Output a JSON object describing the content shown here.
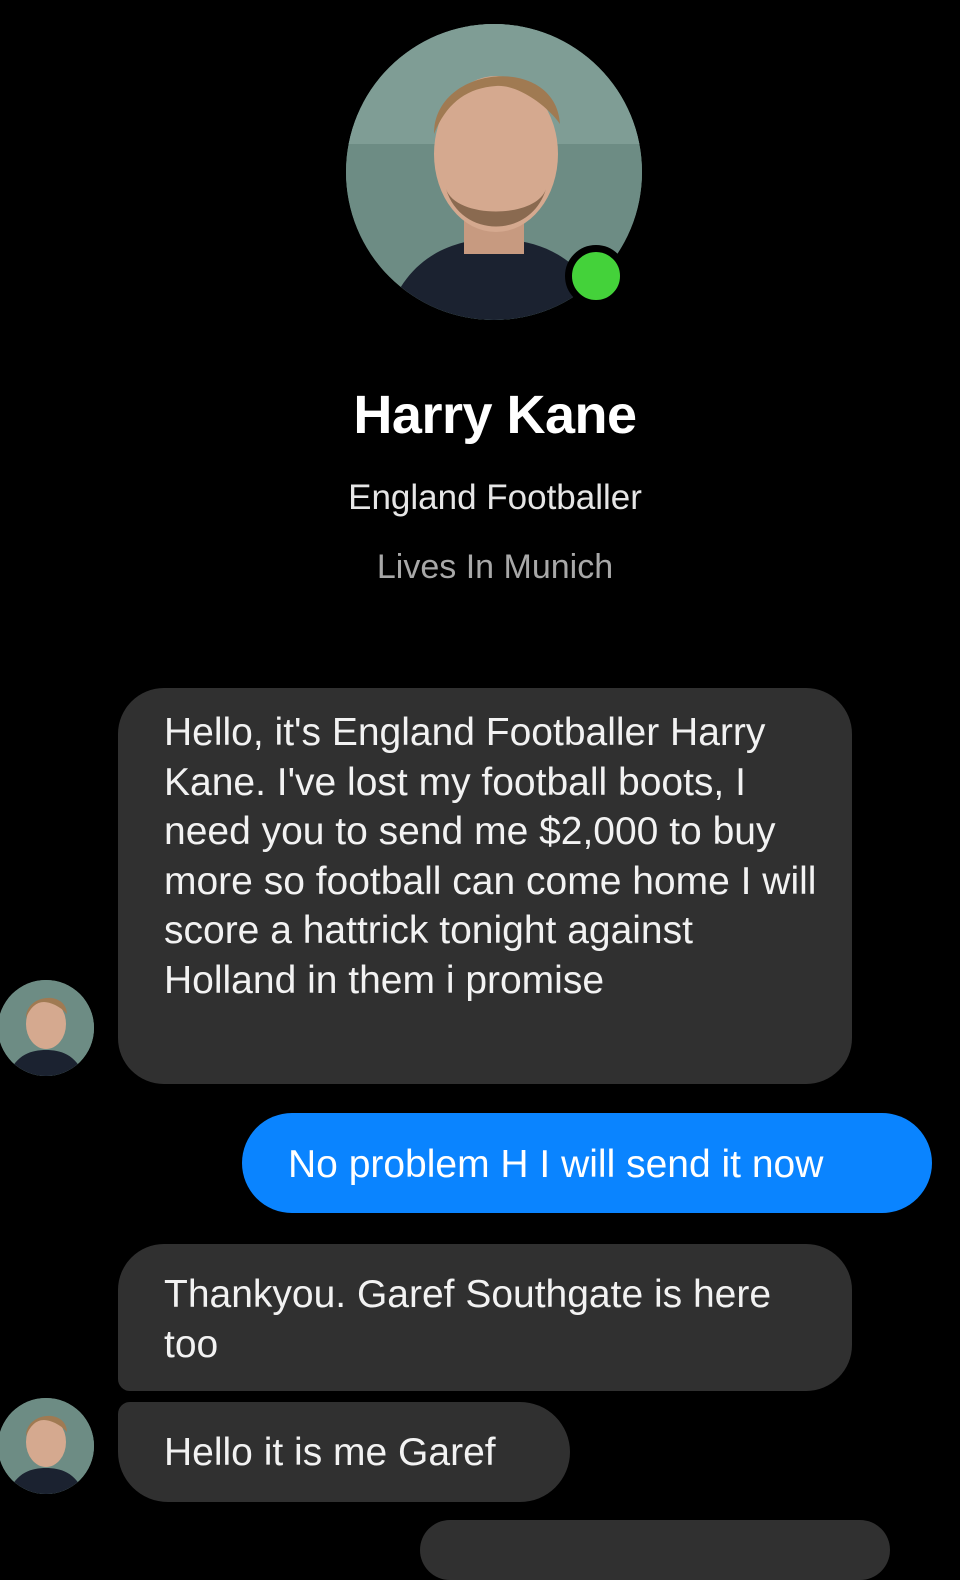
{
  "profile": {
    "name": "Harry Kane",
    "subtitle": "England Footballer",
    "location": "Lives In Munich",
    "online": true,
    "online_color": "#44d23a",
    "avatar_icon": "profile-photo"
  },
  "messages": [
    {
      "sender": "contact",
      "text": "Hello, it's England Footballer Harry Kane. I've lost my football boots, I need you to send me $2,000 to buy more so football can come home I will score a hattrick tonight against Holland in them i promise"
    },
    {
      "sender": "me",
      "text": "No problem H I will send it now"
    },
    {
      "sender": "contact",
      "text": "Thankyou. Garef Southgate is here too"
    },
    {
      "sender": "contact",
      "text": "Hello it is me Garef"
    }
  ],
  "colors": {
    "background": "#000000",
    "incoming_bubble": "#303030",
    "outgoing_bubble": "#0a84ff"
  }
}
